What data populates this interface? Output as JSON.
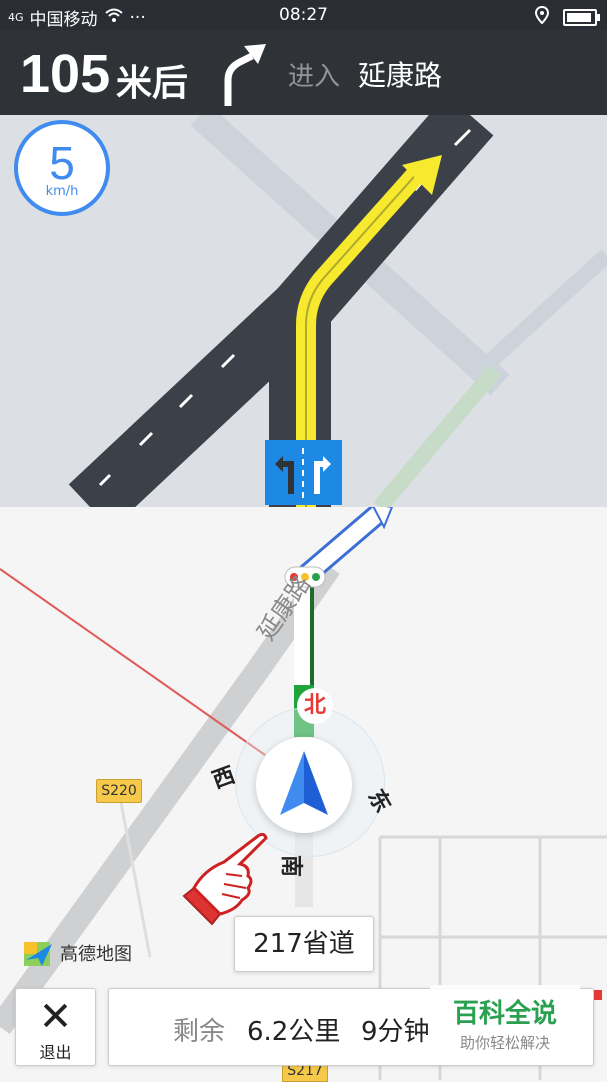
{
  "status_bar": {
    "signal_label": "4G",
    "carrier": "中国移动",
    "dots": "···",
    "time": "08:27"
  },
  "guidance": {
    "distance_value": "105",
    "distance_unit": "米后",
    "enter_label": "进入",
    "road_name": "延康路"
  },
  "speed": {
    "value": "5",
    "unit": "km/h"
  },
  "map": {
    "road_name_on_map": "延康路",
    "compass": {
      "north": "北",
      "west": "西",
      "east": "东",
      "south": "南"
    },
    "current_road": "217省道",
    "shield_s220": "S220",
    "shield_s217": "S217",
    "brand": "高德地图"
  },
  "bottom": {
    "exit_label": "退出",
    "remain_label": "剩余",
    "remain_distance": "6.2公里",
    "remain_time": "9分钟"
  },
  "watermark": {
    "title": "百科全说",
    "subtitle": "助你轻松解决"
  },
  "colors": {
    "route_blue": "#1e88e5",
    "route_yellow": "#f7ea2e",
    "route_green": "#1fa53b",
    "accent": "#3f8bf0"
  }
}
